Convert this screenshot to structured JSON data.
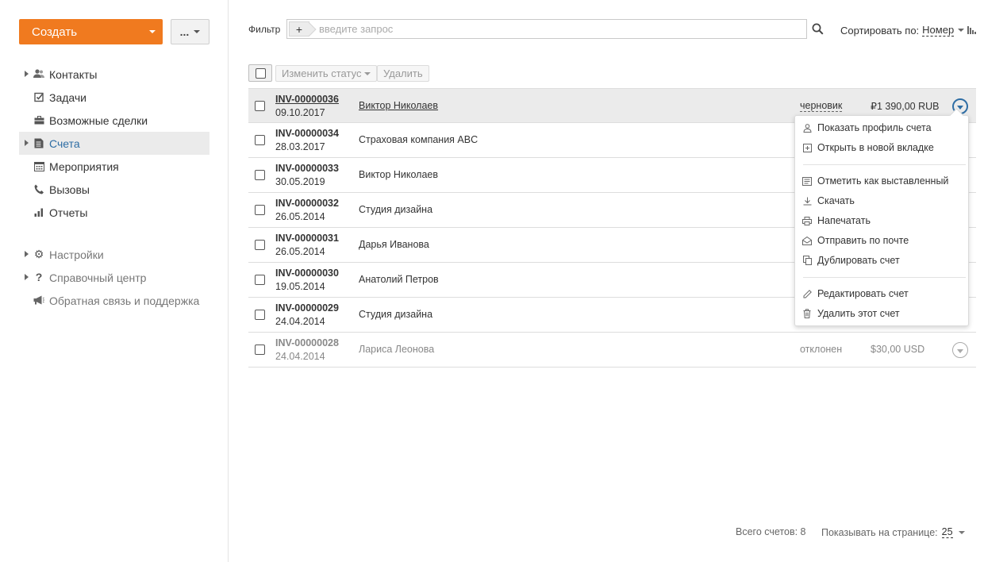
{
  "sidebar": {
    "create_label": "Создать",
    "more_label": "...",
    "items": [
      {
        "label": "Контакты",
        "icon": "contacts-icon"
      },
      {
        "label": "Задачи",
        "icon": "tasks-icon"
      },
      {
        "label": "Возможные сделки",
        "icon": "deals-icon"
      },
      {
        "label": "Счета",
        "icon": "invoices-icon"
      },
      {
        "label": "Мероприятия",
        "icon": "calendar-icon"
      },
      {
        "label": "Вызовы",
        "icon": "phone-icon"
      },
      {
        "label": "Отчеты",
        "icon": "reports-icon"
      }
    ],
    "secondary": [
      {
        "label": "Настройки",
        "icon": "gear-icon"
      },
      {
        "label": "Справочный центр",
        "icon": "help-icon"
      },
      {
        "label": "Обратная связь и поддержка",
        "icon": "megaphone-icon"
      }
    ]
  },
  "topbar": {
    "filter_label": "Фильтр",
    "filter_placeholder": "введите запрос",
    "sort_label": "Сортировать по:",
    "sort_value": "Номер"
  },
  "toolbar": {
    "change_status": "Изменить статус",
    "delete": "Удалить"
  },
  "invoices": [
    {
      "number": "INV-00000036",
      "date": "09.10.2017",
      "client": "Виктор Николаев",
      "status": "черновик",
      "amount": "₽1 390,00 RUB"
    },
    {
      "number": "INV-00000034",
      "date": "28.03.2017",
      "client": "Страховая компания ABC",
      "status": "",
      "amount": ""
    },
    {
      "number": "INV-00000033",
      "date": "30.05.2019",
      "client": "Виктор Николаев",
      "status": "",
      "amount": ""
    },
    {
      "number": "INV-00000032",
      "date": "26.05.2014",
      "client": "Студия дизайна",
      "status": "",
      "amount": ""
    },
    {
      "number": "INV-00000031",
      "date": "26.05.2014",
      "client": "Дарья Иванова",
      "status": "",
      "amount": ""
    },
    {
      "number": "INV-00000030",
      "date": "19.05.2014",
      "client": "Анатолий Петров",
      "status": "",
      "amount": ""
    },
    {
      "number": "INV-00000029",
      "date": "24.04.2014",
      "client": "Студия дизайна",
      "status": "",
      "amount": ""
    },
    {
      "number": "INV-00000028",
      "date": "24.04.2014",
      "client": "Лариса Леонова",
      "status": "отклонен",
      "amount": "$30,00 USD"
    }
  ],
  "context_menu": {
    "items": [
      {
        "label": "Показать профиль счета",
        "icon": "profile-icon"
      },
      {
        "label": "Открыть в новой вкладке",
        "icon": "new-tab-icon"
      },
      {
        "label": "Отметить как выставленный",
        "icon": "mark-sent-icon"
      },
      {
        "label": "Скачать",
        "icon": "download-icon"
      },
      {
        "label": "Напечатать",
        "icon": "print-icon"
      },
      {
        "label": "Отправить по почте",
        "icon": "mail-icon"
      },
      {
        "label": "Дублировать счет",
        "icon": "duplicate-icon"
      },
      {
        "label": "Редактировать счет",
        "icon": "edit-icon"
      },
      {
        "label": "Удалить этот счет",
        "icon": "trash-icon"
      }
    ]
  },
  "footer": {
    "total_label": "Всего счетов: 8",
    "per_page_label": "Показывать на странице:",
    "per_page_value": "25"
  },
  "colors": {
    "accent": "#f07a1f",
    "link_active": "#2e6da4",
    "selected_row": "#ebebeb"
  }
}
